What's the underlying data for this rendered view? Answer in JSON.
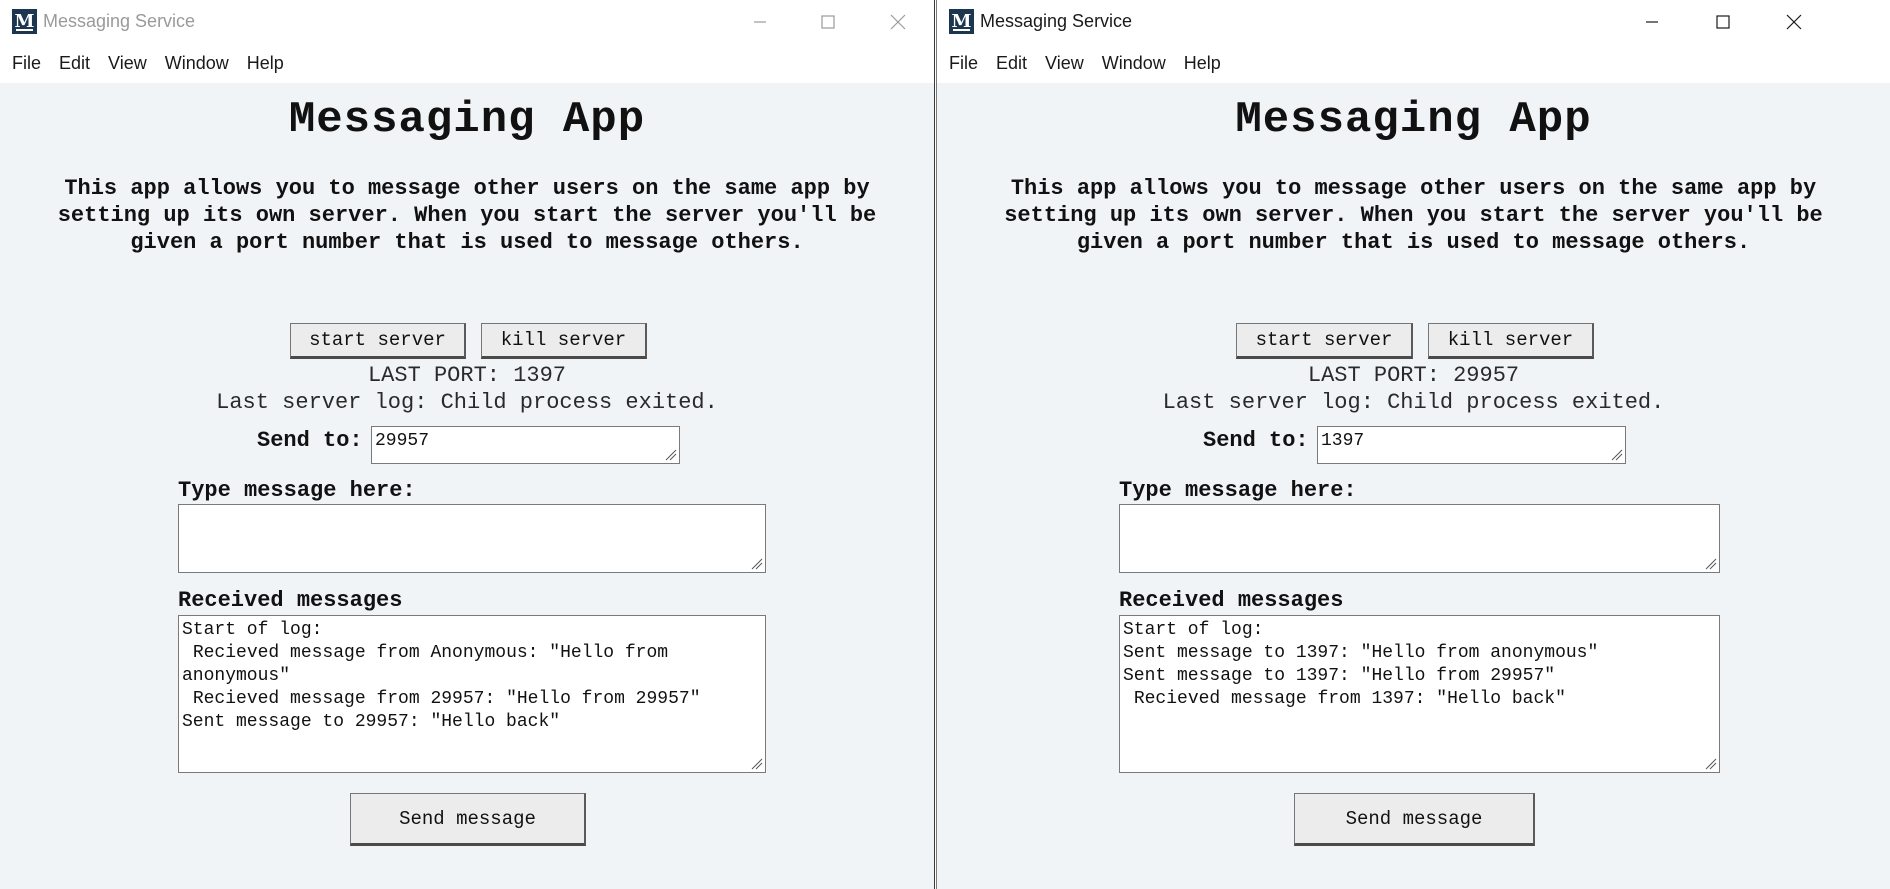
{
  "windows": [
    {
      "id": "left",
      "title": "Messaging Service",
      "icon_letter": "M",
      "menu": [
        "File",
        "Edit",
        "View",
        "Window",
        "Help"
      ],
      "app_title": "Messaging App",
      "description": "This app allows you to message other users on the same app by setting up its own server. When you start the server you'll be given a port number that is used to message others.",
      "start_button": "start server",
      "kill_button": "kill server",
      "last_port": "LAST PORT: 1397",
      "server_log": "Last server log: Child process exited.",
      "send_to_label": "Send to:",
      "send_to_value": "29957",
      "message_label": "Type message here:",
      "message_value": "",
      "received_label": "Received messages",
      "received_log": "Start of log:\n Recieved message from Anonymous: \"Hello from anonymous\"\n Recieved message from 29957: \"Hello from 29957\"\nSent message to 29957: \"Hello back\"",
      "send_button": "Send message"
    },
    {
      "id": "right",
      "title": "Messaging Service",
      "icon_letter": "M",
      "menu": [
        "File",
        "Edit",
        "View",
        "Window",
        "Help"
      ],
      "app_title": "Messaging App",
      "description": "This app allows you to message other users on the same app by setting up its own server. When you start the server you'll be given a port number that is used to message others.",
      "start_button": "start server",
      "kill_button": "kill server",
      "last_port": "LAST PORT: 29957",
      "server_log": "Last server log: Child process exited.",
      "send_to_label": "Send to:",
      "send_to_value": "1397",
      "message_label": "Type message here:",
      "message_value": "",
      "received_label": "Received messages",
      "received_log": "Start of log:\nSent message to 1397: \"Hello from anonymous\"\nSent message to 1397: \"Hello from 29957\"\n Recieved message from 1397: \"Hello back\"",
      "send_button": "Send message"
    }
  ],
  "colors": {
    "icon_bg": "#1c3650",
    "content_bg": "#f0f4f7",
    "inactive_title": "#9a9a9a"
  },
  "icons": {
    "minimize": "minimize-icon",
    "maximize": "maximize-icon",
    "close": "close-icon",
    "resize_grip": "resize-grip-icon"
  }
}
